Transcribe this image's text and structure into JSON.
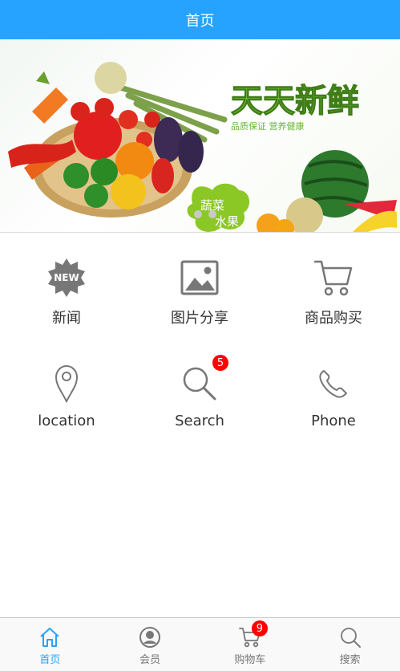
{
  "header": {
    "title": "首页"
  },
  "banner": {
    "headline": "天天新鲜",
    "tagline": "品质保证  营养健康",
    "bubble_line1": "蔬菜",
    "bubble_line2": "水果",
    "slide_count": 2
  },
  "grid": [
    {
      "label": "新闻",
      "icon": "new-badge-icon",
      "badge_text": "NEW"
    },
    {
      "label": "图片分享",
      "icon": "image-icon"
    },
    {
      "label": "商品购买",
      "icon": "cart-icon"
    },
    {
      "label": "location",
      "icon": "location-pin-icon"
    },
    {
      "label": "Search",
      "icon": "search-icon",
      "badge": "5"
    },
    {
      "label": "Phone",
      "icon": "phone-icon"
    }
  ],
  "tabbar": [
    {
      "label": "首页",
      "icon": "home-icon",
      "active": true
    },
    {
      "label": "会员",
      "icon": "user-icon"
    },
    {
      "label": "购物车",
      "icon": "cart-icon",
      "badge": "9"
    },
    {
      "label": "搜索",
      "icon": "search-icon"
    }
  ],
  "colors": {
    "primary": "#26a2ff",
    "badge": "#ff0000",
    "icon_gray": "#777777"
  }
}
